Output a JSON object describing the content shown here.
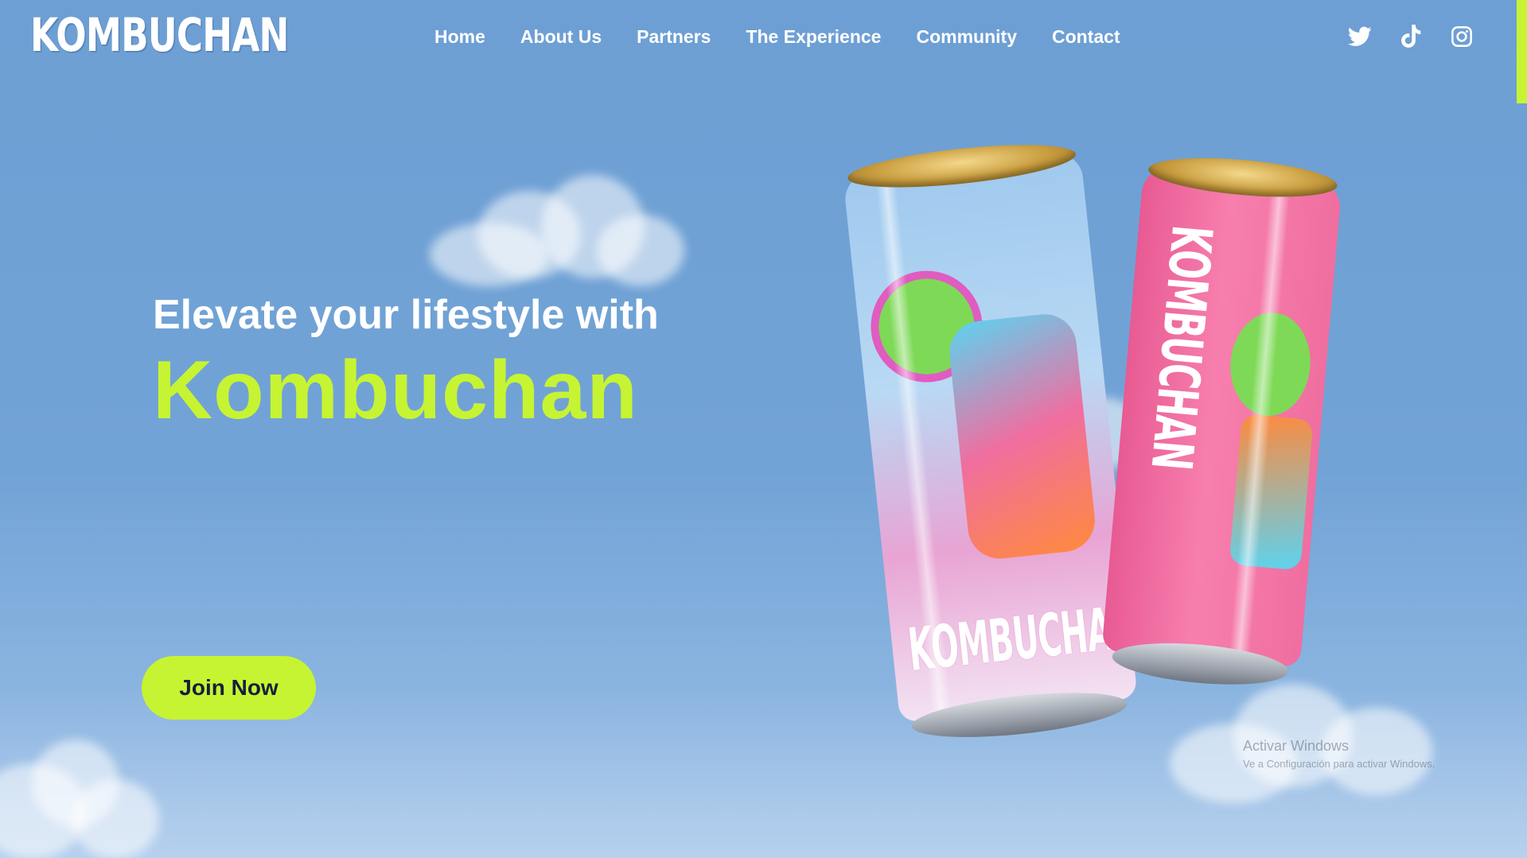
{
  "brand": {
    "logo_text": "KOMBUCHAN"
  },
  "nav": {
    "items": [
      {
        "label": "Home"
      },
      {
        "label": "About Us"
      },
      {
        "label": "Partners"
      },
      {
        "label": "The Experience"
      },
      {
        "label": "Community"
      },
      {
        "label": "Contact"
      }
    ]
  },
  "social": {
    "icons": [
      "twitter-icon",
      "tiktok-icon",
      "instagram-icon"
    ]
  },
  "hero": {
    "subtitle": "Elevate your lifestyle with",
    "title": "Kombuchan",
    "cta_label": "Join Now"
  },
  "product": {
    "can_left_word": "KOMBUCHAN",
    "can_right_word": "KOMBUCHAN"
  },
  "watermark": {
    "line1": "Activar Windows",
    "line2": "Ve a Configuración para activar Windows."
  },
  "colors": {
    "background": "#72a3d6",
    "accent": "#c6f432",
    "text_light": "#ffffff",
    "button_text": "#14203a",
    "can_pink": "#f06ea0",
    "can_clear": "#a9cdef"
  }
}
